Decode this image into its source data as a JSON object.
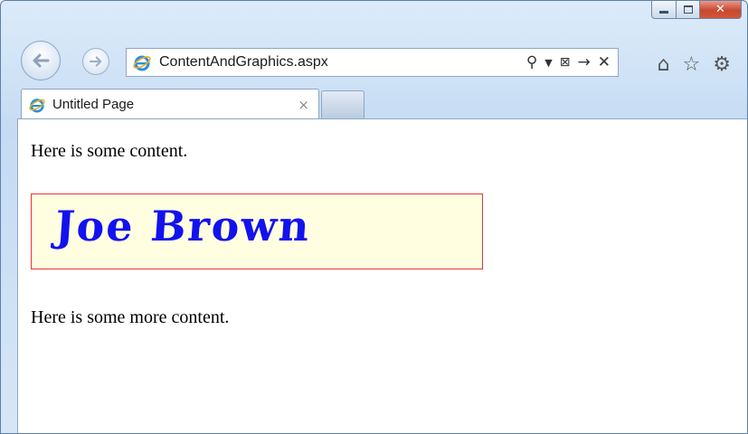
{
  "window": {
    "address": "ContentAndGraphics.aspx",
    "tab_label": "Untitled Page",
    "tab_close_glyph": "×"
  },
  "content": {
    "paragraph_1": "Here is some content.",
    "banner_text": "Joe Brown",
    "paragraph_2": "Here is some more content."
  },
  "icons": {
    "back": "back-arrow-icon",
    "forward": "forward-arrow-icon",
    "search": "search-icon",
    "dropdown": "chevron-down-icon",
    "compat": "compatibility-view-icon",
    "go": "go-arrow-icon",
    "stop": "close-icon",
    "home": "home-icon",
    "favorites": "star-icon",
    "tools": "gear-icon"
  },
  "colors": {
    "banner_bg": "#fffee1",
    "banner_border": "#ee3333",
    "banner_text": "#1212ee"
  }
}
